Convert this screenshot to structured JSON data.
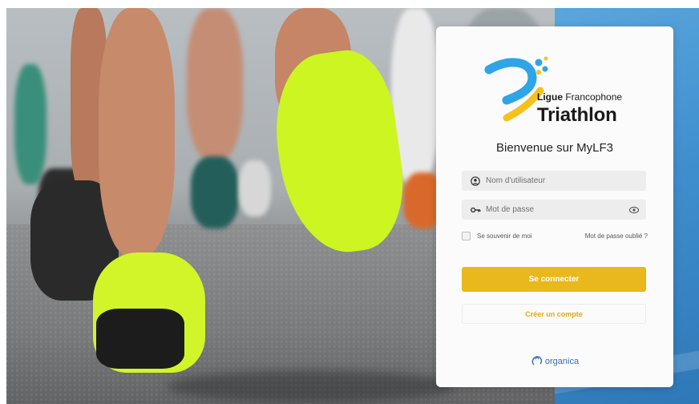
{
  "brand": {
    "line1_bold": "Ligue",
    "line1_rest": " Francophone",
    "line2": "Triathlon",
    "colors": {
      "blue": "#2fa4e7",
      "yellow": "#f4c21c",
      "accent": "#e8b81c"
    }
  },
  "login": {
    "welcome": "Bienvenue sur MyLF3",
    "username_placeholder": "Nom d'utilisateur",
    "password_placeholder": "Mot de passe",
    "remember_label": "Se souvenir de moi",
    "forgot_label": "Mot de passe oublié ?",
    "submit_label": "Se connecter",
    "register_label": "Créer un compte"
  },
  "footer": {
    "provider": "organica"
  },
  "icons": {
    "user": "user-circle-icon",
    "key": "key-icon",
    "eye": "eye-icon",
    "organica": "organica-logo-icon"
  }
}
